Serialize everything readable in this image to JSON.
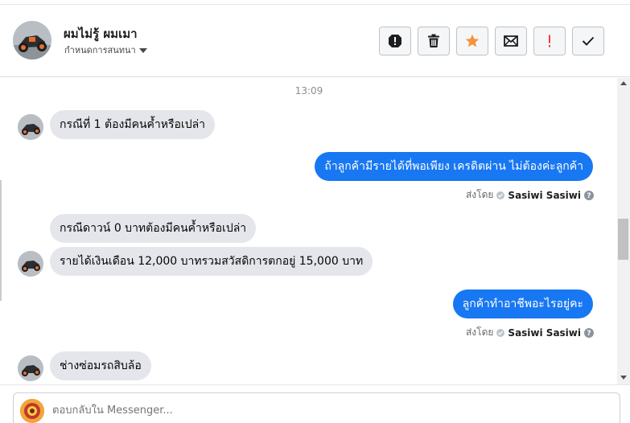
{
  "header": {
    "contact_name": "ผมไม่รู้ ผมเมา",
    "subtitle": "กำหนดการสนทนา",
    "actions": [
      {
        "icon": "exclamation-circle-icon"
      },
      {
        "icon": "trash-icon"
      },
      {
        "icon": "star-icon",
        "color": "#f7923b"
      },
      {
        "icon": "envelope-icon"
      },
      {
        "icon": "exclamation-icon",
        "color": "#fa383e"
      },
      {
        "icon": "checkmark-icon"
      }
    ]
  },
  "thread": {
    "timestamp": "13:09",
    "messages": [
      {
        "direction": "in",
        "text": "กรณีที่ 1 ต้องมีคนค้ำหรือเปล่า"
      },
      {
        "direction": "out",
        "text": "ถ้าลูกค้ามีรายได้ที่พอเพียง เครดิตผ่าน ไม่ต้องค่ะลูกค้า",
        "sent_by_label": "ส่งโดย",
        "sender": "Sasiwi Sasiwi"
      },
      {
        "direction": "in",
        "text": "กรณีดาวน์ 0 บาทต้องมีคนค้ำหรือเปล่า"
      },
      {
        "direction": "in",
        "text": "รายได้เงินเดือน 12,000 บาทรวมสวัสดิการตกอยู่ 15,000 บาท"
      },
      {
        "direction": "out",
        "text": "ลูกค้าทำอาชีพอะไรอยู่คะ",
        "sent_by_label": "ส่งโดย",
        "sender": "Sasiwi Sasiwi"
      },
      {
        "direction": "in",
        "text": "ช่างซ่อมรถสิบล้อ"
      }
    ]
  },
  "composer": {
    "placeholder": "ตอบกลับใน Messenger..."
  },
  "colors": {
    "outgoing_bubble": "#1877f2",
    "incoming_bubble": "#e4e6eb"
  }
}
